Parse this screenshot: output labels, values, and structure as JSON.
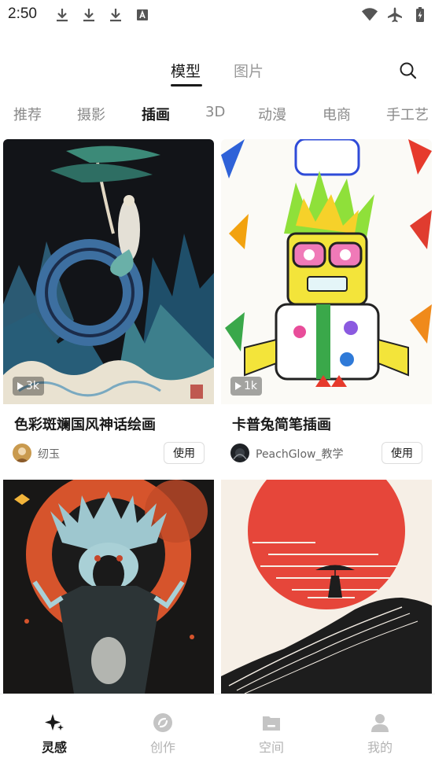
{
  "status_bar": {
    "time": "2:50",
    "left_icons": [
      "download-icon",
      "download-icon",
      "download-icon",
      "font-a-icon"
    ],
    "right_icons": [
      "wifi-icon",
      "airplane-icon",
      "battery-charging-icon"
    ]
  },
  "top_tabs": [
    {
      "label": "模型",
      "active": true
    },
    {
      "label": "图片",
      "active": false
    }
  ],
  "categories": [
    {
      "label": "推荐",
      "active": false
    },
    {
      "label": "摄影",
      "active": false
    },
    {
      "label": "插画",
      "active": true
    },
    {
      "label": "3D",
      "active": false
    },
    {
      "label": "动漫",
      "active": false
    },
    {
      "label": "电商",
      "active": false
    },
    {
      "label": "手工艺",
      "active": false
    }
  ],
  "cards": [
    {
      "title": "色彩斑斓国风神话绘画",
      "plays": "3k",
      "author": "纫玉",
      "use_label": "使用"
    },
    {
      "title": "卡普兔简笔插画",
      "plays": "1k",
      "author": "PeachGlow_教学",
      "use_label": "使用"
    }
  ],
  "bottom_nav": [
    {
      "label": "灵感",
      "icon": "sparkle-icon",
      "active": true
    },
    {
      "label": "创作",
      "icon": "create-icon",
      "active": false
    },
    {
      "label": "空间",
      "icon": "folder-icon",
      "active": false
    },
    {
      "label": "我的",
      "icon": "user-icon",
      "active": false
    }
  ],
  "colors": {
    "active_text": "#1a1a1a",
    "inactive_text": "#999999",
    "nav_inactive": "#b3b3b3"
  }
}
